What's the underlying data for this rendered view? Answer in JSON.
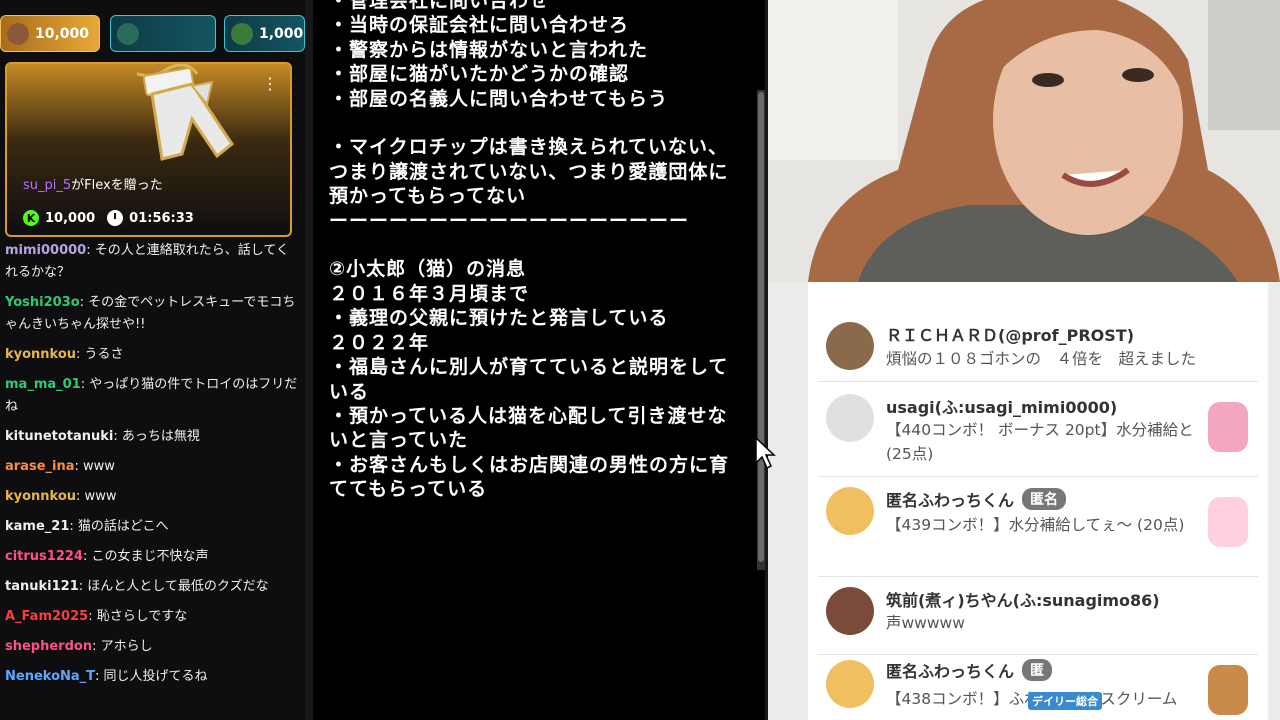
{
  "gift_tabs": [
    {
      "amount": "10,000",
      "color": "#e8a838"
    },
    {
      "amount": "",
      "color": "#135562"
    },
    {
      "amount": "1,000",
      "color": "#135562"
    }
  ],
  "gift_card": {
    "user": "su_pi_5",
    "action": "がFlexを贈った",
    "amount": "10,000",
    "timer": "01:56:33",
    "menu": "⋮"
  },
  "chat": [
    {
      "user": "mimi00000",
      "text": ": その人と連絡取れたら、話してくれるかな？",
      "color": "#b9a3e3"
    },
    {
      "user": "Yoshi203o",
      "text": ": その金でペットレスキューでモコちゃんきいちゃん探せや!!",
      "color": "#2ecc71"
    },
    {
      "user": "kyonnkou",
      "text": ": うるさ",
      "color": "#e8b54a"
    },
    {
      "user": "ma_ma_01",
      "text": ": やっぱり猫の件でトロイのはフリだね",
      "color": "#2ecc71"
    },
    {
      "user": "kitunetotanuki",
      "text": ": あっちは無視",
      "color": "#efeff1"
    },
    {
      "user": "arase_ina",
      "text": ": www",
      "color": "#ff8c42"
    },
    {
      "user": "kyonnkou",
      "text": ": www",
      "color": "#e8b54a"
    },
    {
      "user": "kame_21",
      "text": ": 猫の話はどこへ",
      "color": "#efeff1"
    },
    {
      "user": "citrus1224",
      "text": ": この女まじ不快な声",
      "color": "#ff4f8b"
    },
    {
      "user": "tanuki121",
      "text": ": ほんと人として最低のクズだな",
      "color": "#efeff1"
    },
    {
      "user": "A_Fam2025",
      "text": ": 恥さらしですな",
      "color": "#ff3b3b"
    },
    {
      "user": "shepherdon",
      "text": ": アホらし",
      "color": "#ff4f8b"
    },
    {
      "user": "NenekoNa_T",
      "text": ": 同じ人投げてるね",
      "color": "#5aa9ff"
    }
  ],
  "note": "・管理会社に問い合わせ\n・当時の保証会社に問い合わせろ\n・警察からは情報がないと言われた\n・部屋に猫がいたかどうかの確認\n・部屋の名義人に問い合わせてもらう\n\n・マイクロチップは書き換えられていない、つまり譲渡されていない、つまり愛護団体に預かってもらってない\nーーーーーーーーーーーーーーーーーー\n\n②小太郎（猫）の消息\n２０１６年３月頃まで\n・義理の父親に預けたと発言している\n２０２２年\n・福島さんに別人が育てていると説明をしている\n・預かっている人は猫を心配して引き渡せないと言っていた\n・お客さんもしくはお店関連の男性の方に育ててもらっている",
  "comments": [
    {
      "name": "ＲＩＣＨＡＲＤ(@prof_PROST)",
      "body": "煩悩の１０８ゴホンの　４倍を　超えました",
      "anon": ""
    },
    {
      "name": "usagi(ふ:usagi_mimi0000)",
      "body": "【440コンボ！ ボーナス 20pt】水分補給と (25点)",
      "anon": ""
    },
    {
      "name": "匿名ふわっちくん",
      "body": "【439コンボ！】水分補給してぇ〜 (20点)",
      "anon": "匿名"
    },
    {
      "name": "筑前(煮ィ)ちやん(ふ:sunagimo86)",
      "body": "声wwwww",
      "anon": ""
    },
    {
      "name": "匿名ふわっちくん",
      "body": "【438コンボ！】ふわっとアイスクリーム",
      "anon": "匿"
    }
  ],
  "video_overlay_text": "デイリー総合"
}
